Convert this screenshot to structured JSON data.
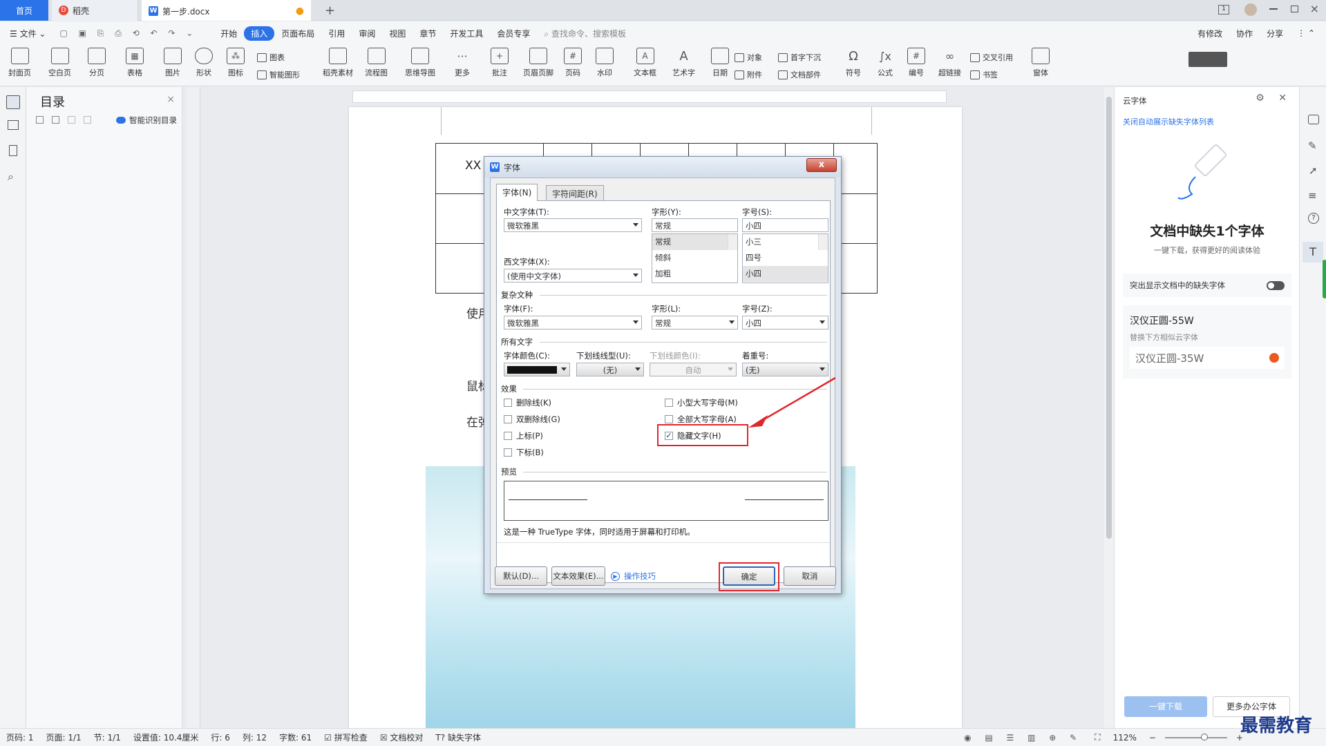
{
  "tabs": {
    "home": "首页",
    "daoke": "稻壳",
    "doc": "第一步.docx",
    "add": "+"
  },
  "menu": {
    "file": "文件",
    "items": [
      "开始",
      "插入",
      "页面布局",
      "引用",
      "审阅",
      "视图",
      "章节",
      "开发工具",
      "会员专享"
    ],
    "search_placeholder": "查找命令、搜索模板",
    "right": [
      "有修改",
      "协作",
      "分享"
    ]
  },
  "ribbon": {
    "big": [
      "封面页",
      "空白页",
      "分页",
      "表格",
      "图片",
      "形状",
      "图标",
      "稻壳素材",
      "流程图",
      "思维导图",
      "更多",
      "批注",
      "页眉页脚",
      "页码",
      "水印",
      "文本框",
      "艺术字",
      "日期",
      "符号",
      "公式",
      "编号",
      "超链接",
      "窗体"
    ],
    "small": [
      "图表",
      "智能图形",
      "对象",
      "附件",
      "首字下沉",
      "文档部件",
      "交叉引用",
      "书签"
    ]
  },
  "toc": {
    "title": "目录",
    "smart": "智能识别目录"
  },
  "document": {
    "cell_text": "XX",
    "para1": "使用",
    "para2": "鼠标",
    "para3": "在弹"
  },
  "dialog": {
    "title": "字体",
    "close": "x",
    "tab_font": "字体(N)",
    "tab_spacing": "字符间距(R)",
    "cn_font_label": "中文字体(T):",
    "cn_font_value": "微软雅黑",
    "style_label": "字形(Y):",
    "style_value": "常规",
    "size_label": "字号(S):",
    "size_value": "小四",
    "style_list": [
      "常规",
      "倾斜",
      "加粗"
    ],
    "size_list": [
      "小三",
      "四号",
      "小四"
    ],
    "west_font_label": "西文字体(X):",
    "west_font_value": "(使用中文字体)",
    "complex_section": "复杂文种",
    "complex_font_label": "字体(F):",
    "complex_font_value": "微软雅黑",
    "complex_style_label": "字形(L):",
    "complex_style_value": "常规",
    "complex_size_label": "字号(Z):",
    "complex_size_value": "小四",
    "all_text_section": "所有文字",
    "color_label": "字体颜色(C):",
    "underline_label": "下划线线型(U):",
    "underline_value": "(无)",
    "underline_color_label": "下划线颜色(I):",
    "underline_color_value": "自动",
    "emphasis_label": "着重号:",
    "emphasis_value": "(无)",
    "effects_section": "效果",
    "effects": {
      "strike": "删除线(K)",
      "double_strike": "双删除线(G)",
      "superscript": "上标(P)",
      "subscript": "下标(B)",
      "small_caps": "小型大写字母(M)",
      "all_caps": "全部大写字母(A)",
      "hidden": "隐藏文字(H)"
    },
    "hidden_checked": true,
    "preview_section": "预览",
    "preview_note": "这是一种 TrueType 字体，同时适用于屏幕和打印机。",
    "btn_default": "默认(D)...",
    "btn_text_effects": "文本效果(E)...",
    "link_tips": "操作技巧",
    "btn_ok": "确定",
    "btn_cancel": "取消"
  },
  "right_panel": {
    "title": "云字体",
    "link": "关闭自动展示缺失字体列表",
    "headline": "文档中缺失1个字体",
    "sub": "一键下载，获得更好的阅读体验",
    "toggle_label": "突出显示文档中的缺失字体",
    "font_name": "汉仪正圆-55W",
    "replace_hint": "替换下方相似云字体",
    "replace_font": "汉仪正圆-35W",
    "btn_download": "一键下载",
    "btn_more": "更多办公字体"
  },
  "status": {
    "items": [
      "页码: 1",
      "页面: 1/1",
      "节: 1/1",
      "设置值: 10.4厘米",
      "行: 6",
      "列: 12",
      "字数: 61",
      "拼写检查",
      "文档校对",
      "缺失字体"
    ],
    "zoom": "112%"
  },
  "watermark": "最需教育",
  "colors": {
    "accent": "#2b73e8",
    "highlight_red": "#e0262d",
    "arrow_red": "#e0262d"
  }
}
